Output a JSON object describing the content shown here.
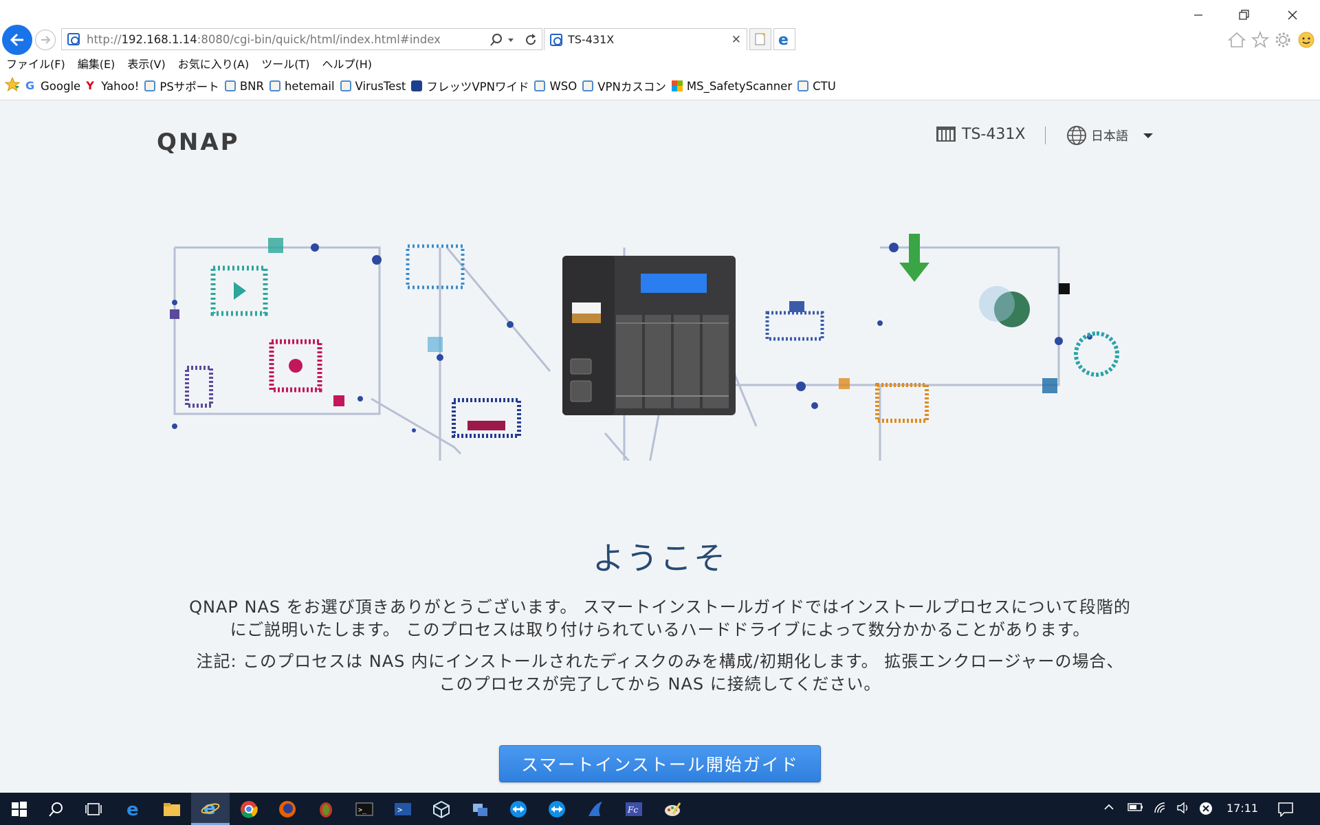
{
  "browser": {
    "url_prefix": "http://",
    "url_host": "192.168.1.14",
    "url_rest": ":8080/cgi-bin/quick/html/index.html#index",
    "tab_title": "TS-431X",
    "window_controls": [
      "minimize-icon",
      "restore-icon",
      "close-icon"
    ],
    "menu": [
      "ファイル(F)",
      "編集(E)",
      "表示(V)",
      "お気に入り(A)",
      "ツール(T)",
      "ヘルプ(H)"
    ],
    "favorites": [
      "Google",
      "Yahoo!",
      "PSサポート",
      "BNR",
      "hetemail",
      "VirusTest",
      "フレッツVPNワイド",
      "WSO",
      "VPNカスコン",
      "MS_SafetyScanner",
      "CTU"
    ]
  },
  "header": {
    "logo": "QNAP",
    "model": "TS-431X",
    "language": "日本語"
  },
  "main": {
    "welcome": "ようこそ",
    "paragraph1_line1": "QNAP NAS をお選び頂きありがとうございます。 スマートインストールガイドではインストールプロセスについて段階的",
    "paragraph1_line2": "にご説明いたします。 このプロセスは取り付けられているハードドライブによって数分かかることがあります。",
    "paragraph2_line1": "注記: このプロセスは NAS 内にインストールされたディスクのみを構成/初期化します。 拡張エンクロージャーの場合、",
    "paragraph2_line2": "このプロセスが完了してから NAS に接続してください。",
    "start_button": "スマートインストール開始ガイド"
  },
  "taskbar": {
    "clock": "17:11"
  },
  "colors": {
    "accent": "#2f80df",
    "heading": "#274b72",
    "taskbar": "#0f1a2d"
  }
}
